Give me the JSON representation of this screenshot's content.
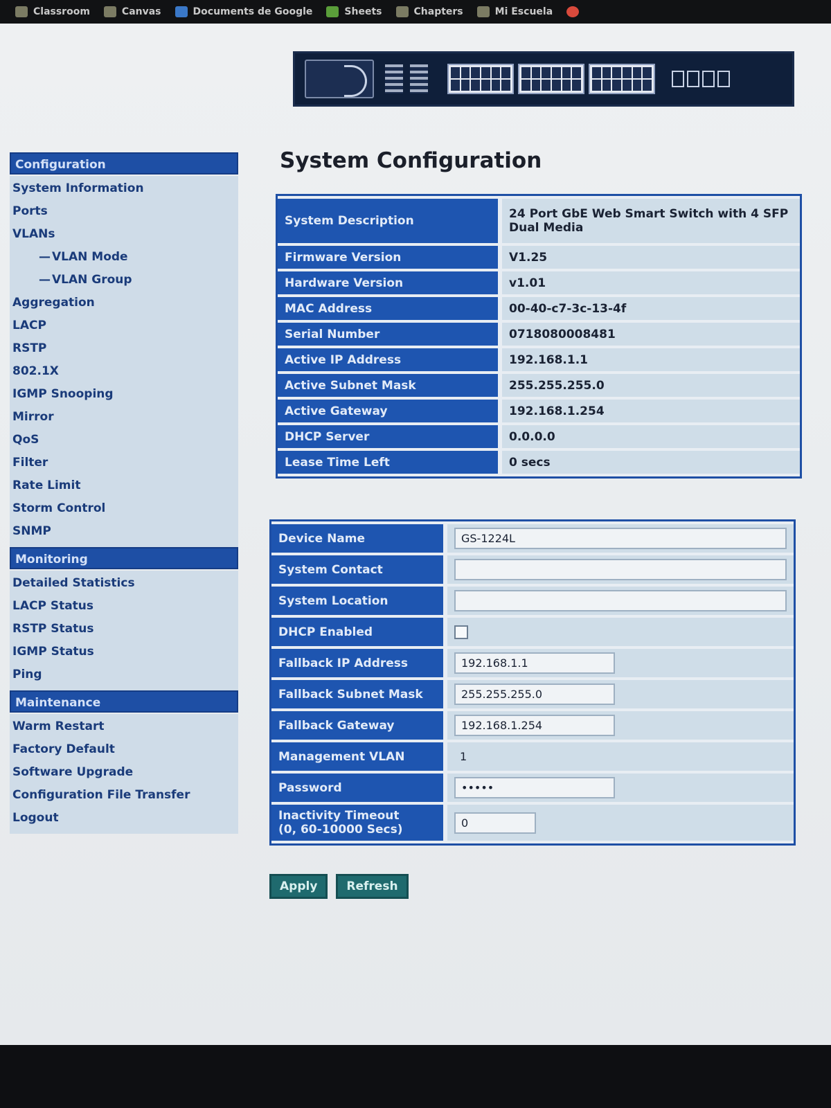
{
  "browser": {
    "bookmarks": [
      {
        "label": "Classroom",
        "icon": "classroom-icon"
      },
      {
        "label": "Canvas",
        "icon": "canvas-icon"
      },
      {
        "label": "Documents de Google",
        "icon": "docs-icon"
      },
      {
        "label": "Sheets",
        "icon": "sheets-icon"
      },
      {
        "label": "Chapters",
        "icon": "chapters-icon"
      },
      {
        "label": "Mi Escuela",
        "icon": "school-icon"
      }
    ]
  },
  "sidebar": {
    "sections": [
      {
        "header": "Configuration",
        "items": [
          {
            "label": "System Information",
            "sub": false
          },
          {
            "label": "Ports",
            "sub": false
          },
          {
            "label": "VLANs",
            "sub": false
          },
          {
            "label": "VLAN Mode",
            "sub": true
          },
          {
            "label": "VLAN Group",
            "sub": true
          },
          {
            "label": "Aggregation",
            "sub": false
          },
          {
            "label": "LACP",
            "sub": false
          },
          {
            "label": "RSTP",
            "sub": false
          },
          {
            "label": "802.1X",
            "sub": false
          },
          {
            "label": "IGMP Snooping",
            "sub": false
          },
          {
            "label": "Mirror",
            "sub": false
          },
          {
            "label": "QoS",
            "sub": false
          },
          {
            "label": "Filter",
            "sub": false
          },
          {
            "label": "Rate Limit",
            "sub": false
          },
          {
            "label": "Storm Control",
            "sub": false
          },
          {
            "label": "SNMP",
            "sub": false
          }
        ]
      },
      {
        "header": "Monitoring",
        "items": [
          {
            "label": "Detailed Statistics",
            "sub": false
          },
          {
            "label": "LACP Status",
            "sub": false
          },
          {
            "label": "RSTP Status",
            "sub": false
          },
          {
            "label": "IGMP Status",
            "sub": false
          },
          {
            "label": "Ping",
            "sub": false
          }
        ]
      },
      {
        "header": "Maintenance",
        "items": [
          {
            "label": "Warm Restart",
            "sub": false
          },
          {
            "label": "Factory Default",
            "sub": false
          },
          {
            "label": "Software Upgrade",
            "sub": false
          },
          {
            "label": "Configuration File Transfer",
            "sub": false
          },
          {
            "label": "Logout",
            "sub": false
          }
        ]
      }
    ]
  },
  "page": {
    "title": "System Configuration"
  },
  "info": {
    "rows": [
      {
        "label": "System Description",
        "value": "24 Port GbE Web Smart Switch with 4 SFP Dual Media"
      },
      {
        "label": "Firmware Version",
        "value": "V1.25"
      },
      {
        "label": "Hardware Version",
        "value": "v1.01"
      },
      {
        "label": "MAC Address",
        "value": "00-40-c7-3c-13-4f"
      },
      {
        "label": "Serial Number",
        "value": "0718080008481"
      },
      {
        "label": "Active IP Address",
        "value": "192.168.1.1"
      },
      {
        "label": "Active Subnet Mask",
        "value": "255.255.255.0"
      },
      {
        "label": "Active Gateway",
        "value": "192.168.1.254"
      },
      {
        "label": "DHCP Server",
        "value": "0.0.0.0"
      },
      {
        "label": "Lease Time Left",
        "value": "0 secs"
      }
    ]
  },
  "config": {
    "device_name": {
      "label": "Device Name",
      "value": "GS-1224L"
    },
    "system_contact": {
      "label": "System Contact",
      "value": ""
    },
    "system_location": {
      "label": "System Location",
      "value": ""
    },
    "dhcp_enabled": {
      "label": "DHCP Enabled",
      "checked": false
    },
    "fallback_ip": {
      "label": "Fallback IP Address",
      "value": "192.168.1.1"
    },
    "fallback_mask": {
      "label": "Fallback Subnet Mask",
      "value": "255.255.255.0"
    },
    "fallback_gateway": {
      "label": "Fallback Gateway",
      "value": "192.168.1.254"
    },
    "management_vlan": {
      "label": "Management VLAN",
      "value": "1"
    },
    "password": {
      "label": "Password",
      "value": "*****"
    },
    "inactivity_timeout": {
      "label": "Inactivity Timeout",
      "label2": "(0, 60-10000 Secs)",
      "value": "0"
    }
  },
  "buttons": {
    "apply": "Apply",
    "refresh": "Refresh"
  },
  "colors": {
    "label_bg": "#1e55b0",
    "value_bg": "#cfdde8",
    "button_bg": "#1f6a6e"
  }
}
